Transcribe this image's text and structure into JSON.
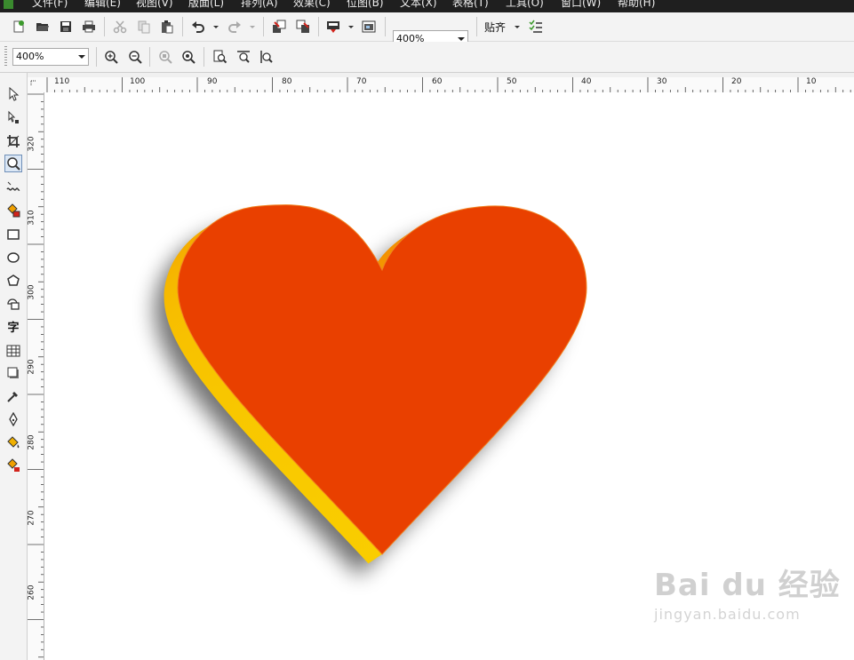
{
  "menubar": {
    "items": [
      "文件(F)",
      "编辑(E)",
      "视图(V)",
      "版面(L)",
      "排列(A)",
      "效果(C)",
      "位图(B)",
      "文本(X)",
      "表格(T)",
      "工具(O)",
      "窗口(W)",
      "帮助(H)"
    ]
  },
  "toolbar": {
    "zoom_value": "400%",
    "snap_label": "贴齐",
    "icons": [
      "new-icon",
      "open-icon",
      "save-icon",
      "print-icon",
      "cut-icon",
      "copy-icon",
      "paste-icon",
      "undo-icon",
      "redo-icon",
      "import-icon",
      "export-icon",
      "publish-icon",
      "app-launcher-icon",
      "options-icon"
    ]
  },
  "zoom_toolbar": {
    "zoom_value": "400%",
    "icons": [
      "zoom-in-icon",
      "zoom-out-icon",
      "zoom-selected-icon",
      "zoom-all-icon",
      "zoom-page-icon",
      "zoom-page-width-icon",
      "zoom-page-height-icon"
    ]
  },
  "toolbox": {
    "tools": [
      "pick-tool",
      "shape-tool",
      "crop-tool",
      "zoom-tool",
      "freehand-tool",
      "smart-fill-tool",
      "rectangle-tool",
      "ellipse-tool",
      "polygon-tool",
      "basic-shapes-tool",
      "text-tool",
      "table-tool",
      "interactive-effects-tool",
      "eyedropper-tool",
      "outline-pen-tool",
      "fill-tool",
      "interactive-fill-tool"
    ],
    "text_tool_label": "字",
    "active_tool": "zoom-tool"
  },
  "rulers": {
    "horizontal_labels": [
      "110",
      "100",
      "90",
      "80",
      "70",
      "60",
      "50",
      "40",
      "30",
      "20",
      "10"
    ],
    "vertical_labels": [
      "320",
      "310",
      "300",
      "290",
      "280",
      "270",
      "260"
    ]
  },
  "canvas": {
    "shape": "heart",
    "face_color": "#E94000",
    "extrude_colors": [
      "#FFF200",
      "#F5B000",
      "#F07000"
    ],
    "shadow": true
  },
  "watermark": {
    "logo_text": "Bai du 经验",
    "url": "jingyan.baidu.com"
  }
}
